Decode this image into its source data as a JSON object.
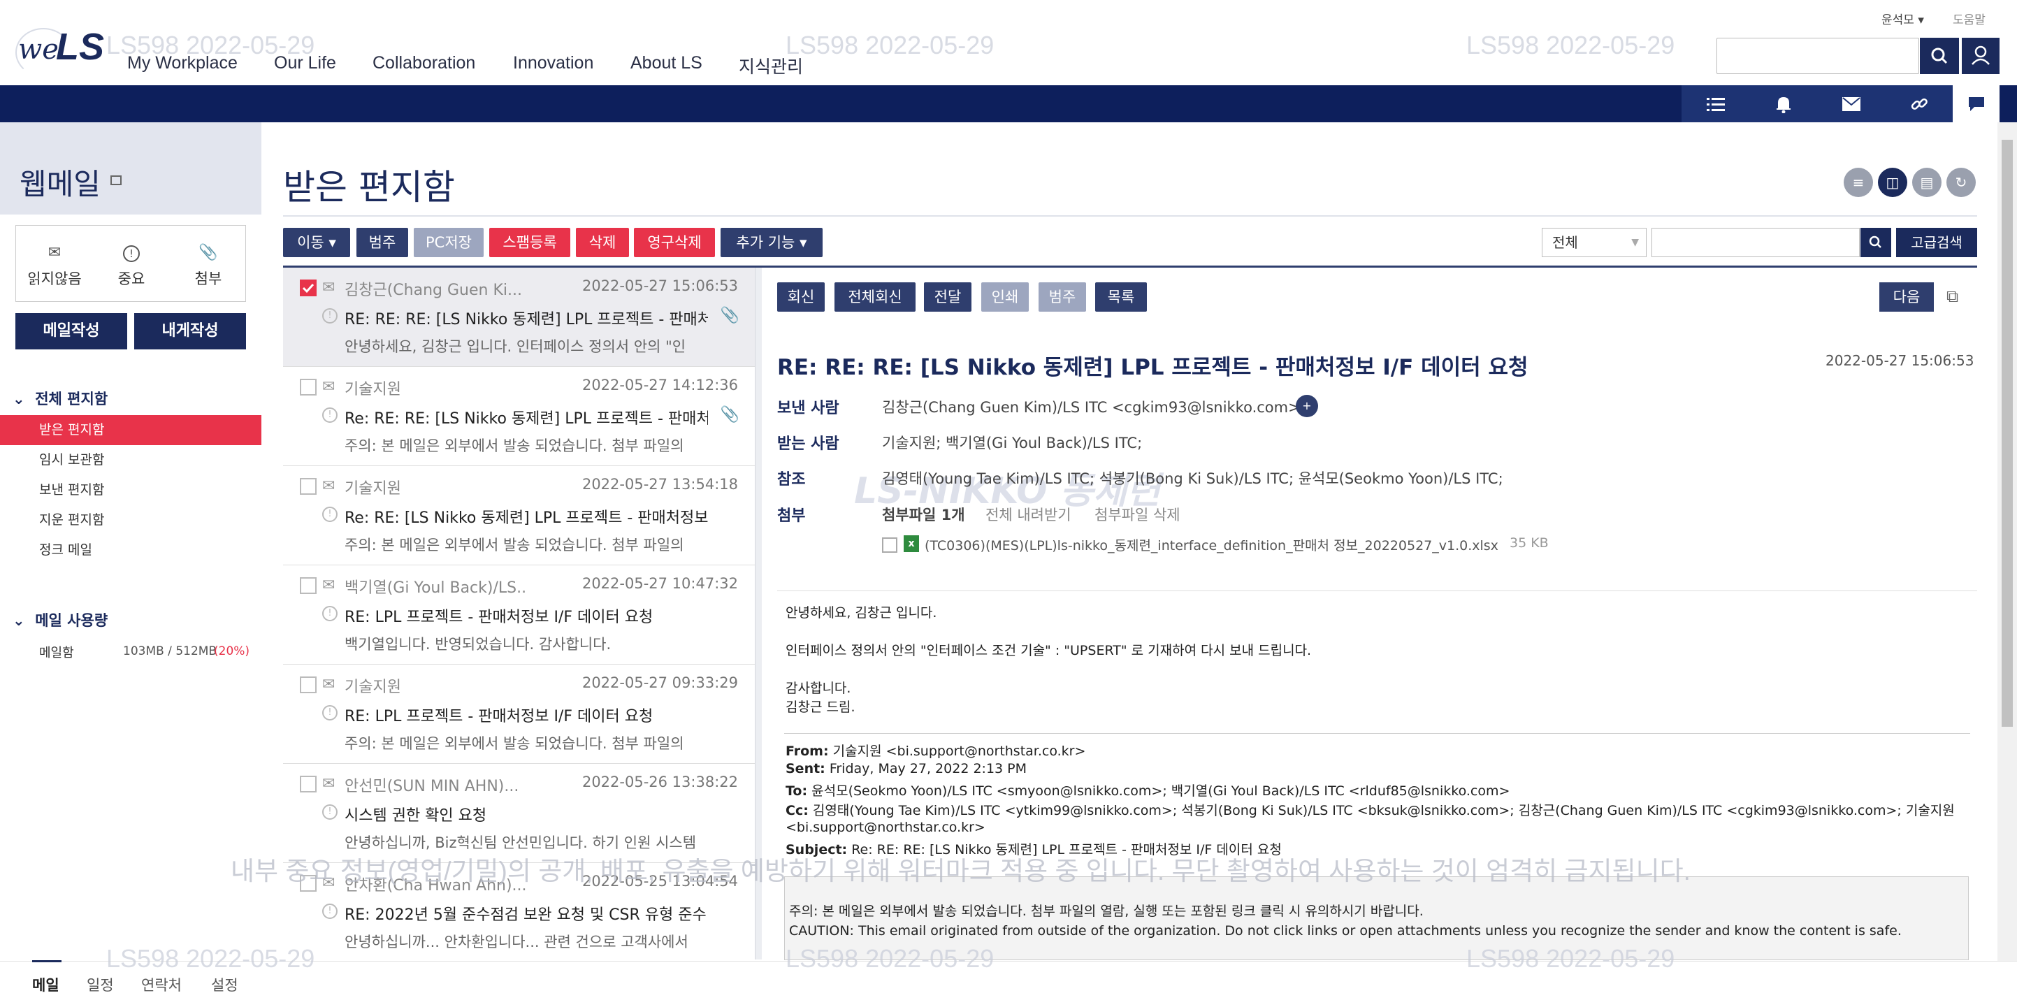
{
  "watermarks": [
    "LS598 2022-05-29",
    "LS598 2022-05-29",
    "LS598 2022-05-29",
    "LS598 2022-05-29",
    "LS598 2022-05-29",
    "LS598 2022-05-29"
  ],
  "security_banner": "내부 중요 정보(영업/기밀)의 공개, 배포, 유출을 예방하기 위해 워터마크 적용 중 입니다. 무단 촬영하여 사용하는 것이 엄격히 금지됩니다.",
  "header": {
    "logo_we": "we",
    "logo_ls": "LS",
    "nav": [
      "My Workplace",
      "Our Life",
      "Collaboration",
      "Innovation",
      "About LS",
      "지식관리"
    ],
    "user_name": "윤석모 ▾",
    "help": "도움말",
    "search_placeholder": ""
  },
  "sidebar": {
    "title": "웹메일",
    "quick": [
      {
        "icon": "envelope-icon",
        "label": "읽지않음"
      },
      {
        "icon": "important-icon",
        "label": "중요"
      },
      {
        "icon": "paperclip-icon",
        "label": "첨부"
      }
    ],
    "compose": "메일작성",
    "compose_self": "내게작성",
    "folders_head": "전체 편지함",
    "folders": [
      "받은 편지함",
      "임시 보관함",
      "보낸 편지함",
      "지운 편지함",
      "정크 메일"
    ],
    "usage_head": "메일 사용량",
    "usage_label": "메일함",
    "usage_value": "103MB / 512MB",
    "usage_pct": "(20%)"
  },
  "main": {
    "title": "받은 편지함",
    "toolbar": {
      "move": "이동 ▾",
      "category": "범주",
      "pc_save": "PC저장",
      "spam": "스팸등록",
      "delete": "삭제",
      "perm_delete": "영구삭제",
      "more": "추가 기능 ▾"
    },
    "filter_select": "전체",
    "filter_value": "",
    "advanced": "고급검색"
  },
  "mails": [
    {
      "from": "김창근(Chang Guen Ki...",
      "date": "2022-05-27 15:06:53",
      "subject": "RE: RE: RE: [LS Nikko 동제련] LPL 프로젝트 - 판매처...",
      "preview": "안녕하세요, 김창근 입니다. 인터페이스 정의서 안의 \"인",
      "attachment": true,
      "selected": true
    },
    {
      "from": "기술지원",
      "date": "2022-05-27 14:12:36",
      "subject": "Re: RE: RE: [LS Nikko 동제련] LPL 프로젝트 - 판매처...",
      "preview": "주의: 본 메일은 외부에서 발송 되었습니다. 첨부 파일의",
      "attachment": true,
      "selected": false
    },
    {
      "from": "기술지원",
      "date": "2022-05-27 13:54:18",
      "subject": "Re: RE: [LS Nikko 동제련] LPL 프로젝트 - 판매처정보 ...",
      "preview": "주의: 본 메일은 외부에서 발송 되었습니다. 첨부 파일의",
      "attachment": false,
      "selected": false
    },
    {
      "from": "백기열(Gi Youl Back)/LS...",
      "date": "2022-05-27 10:47:32",
      "subject": "RE: LPL 프로젝트 - 판매처정보 I/F 데이터 요청",
      "preview": "백기열입니다. 반영되었습니다. 감사합니다.",
      "attachment": false,
      "selected": false
    },
    {
      "from": "기술지원",
      "date": "2022-05-27 09:33:29",
      "subject": "RE: LPL 프로젝트 - 판매처정보 I/F 데이터 요청",
      "preview": "주의: 본 메일은 외부에서 발송 되었습니다. 첨부 파일의",
      "attachment": false,
      "selected": false
    },
    {
      "from": "안선민(SUN MIN AHN)...",
      "date": "2022-05-26 13:38:22",
      "subject": "시스템 권한 확인 요청",
      "preview": "안녕하십니까, Biz혁신팀 안선민입니다. 하기 인원 시스템",
      "attachment": false,
      "selected": false
    },
    {
      "from": "안차환(Cha Hwan Ahn)...",
      "date": "2022-05-25 13:04:54",
      "subject": "RE: 2022년 5월 준수점검 보완 요청 및 CSR 유형 준수...",
      "preview": "안녕하십니까... 안차환입니다... 관련 건으로 고객사에서",
      "attachment": false,
      "selected": false
    }
  ],
  "reader": {
    "buttons": {
      "reply": "회신",
      "reply_all": "전체회신",
      "forward": "전달",
      "print": "인쇄",
      "category": "범주",
      "list": "목록"
    },
    "next": "다음",
    "subject": "RE: RE: RE: [LS Nikko 동제련] LPL 프로젝트 - 판매처정보 I/F 데이터 요청",
    "date": "2022-05-27 15:06:53",
    "labels": {
      "from": "보낸 사람",
      "to": "받는 사람",
      "cc": "참조",
      "attach": "첨부"
    },
    "from": "김창근(Chang Guen Kim)/LS ITC <cgkim93@lsnikko.com>",
    "to": "기술지원; 백기열(Gi Youl Back)/LS ITC;",
    "cc": "김영태(Young Tae Kim)/LS ITC; 석봉기(Bong Ki Suk)/LS ITC; 윤석모(Seokmo Yoon)/LS ITC;",
    "attach_count": "첨부파일 1개",
    "download_all": "전체 내려받기",
    "delete_attach": "첨부파일 삭제",
    "file_name": "(TC0306)(MES)(LPL)ls-nikko_동제련_interface_definition_판매처 정보_20220527_v1.0.xlsx",
    "file_size": "35 KB",
    "watermark_logo": "LS-NIKKO 동제련",
    "body": [
      "안녕하세요, 김창근 입니다.",
      "인터페이스 정의서 안의 \"인터페이스 조건 기술\" : \"UPSERT\" 로 기재하여 다시 보내 드립니다.",
      "감사합니다.",
      "김창근 드림."
    ],
    "quoted": {
      "from_label": "From:",
      "from": " 기술지원 <bi.support@northstar.co.kr>",
      "sent_label": "Sent:",
      "sent": " Friday, May 27, 2022 2:13 PM",
      "to_label": "To:",
      "to": " 윤석모(Seokmo Yoon)/LS ITC <smyoon@lsnikko.com>; 백기열(Gi Youl Back)/LS ITC <rlduf85@lsnikko.com>",
      "cc_label": "Cc:",
      "cc": " 김영태(Young Tae Kim)/LS ITC <ytkim99@lsnikko.com>; 석봉기(Bong Ki Suk)/LS ITC <bksuk@lsnikko.com>; 김창근(Chang Guen Kim)/LS ITC <cgkim93@lsnikko.com>; 기술지원",
      "cc2": "<bi.support@northstar.co.kr>",
      "subject_label": "Subject:",
      "subject": " Re: RE: RE: [LS Nikko 동제련] LPL 프로젝트 - 판매처정보 I/F 데이터 요청"
    },
    "caution_kr": "주의: 본 메일은 외부에서 발송 되었습니다. 첨부 파일의 열람, 실행 또는 포함된 링크 클릭 시 유의하시기 바랍니다.",
    "caution_en": "CAUTION: This email originated from outside of the organization. Do not click links or open attachments unless you recognize the sender and know the content is safe."
  },
  "bottom_nav": [
    "메일",
    "일정",
    "연락처",
    "설정"
  ],
  "colors": {
    "navy": "#1b2a5c",
    "nav_bar": "#0d1f5c",
    "red": "#e8334a",
    "grey_btn": "#9da6bf"
  }
}
